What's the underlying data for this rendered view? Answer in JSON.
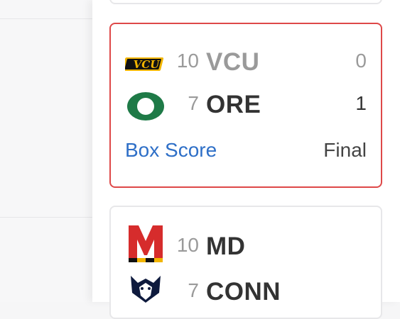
{
  "games": [
    {
      "home": {
        "rank": "10",
        "abbr": "VCU",
        "score": "0",
        "logo": "vcu-logo-icon"
      },
      "away": {
        "rank": "7",
        "abbr": "ORE",
        "score": "1",
        "logo": "oregon-logo-icon"
      },
      "link_label": "Box Score",
      "status": "Final",
      "selected": true,
      "highlight_color": "#de4848"
    },
    {
      "home": {
        "rank": "10",
        "abbr": "MD",
        "logo": "maryland-logo-icon"
      },
      "away": {
        "rank": "7",
        "abbr": "CONN",
        "logo": "uconn-husky-logo-icon"
      }
    }
  ],
  "colors": {
    "link": "#2e6fc7",
    "loser_text": "#9a9a9a",
    "winner_text": "#333333",
    "oregon_green": "#1e7a47",
    "vcu_gold": "#f2b500",
    "maryland_red": "#d62c2c"
  }
}
